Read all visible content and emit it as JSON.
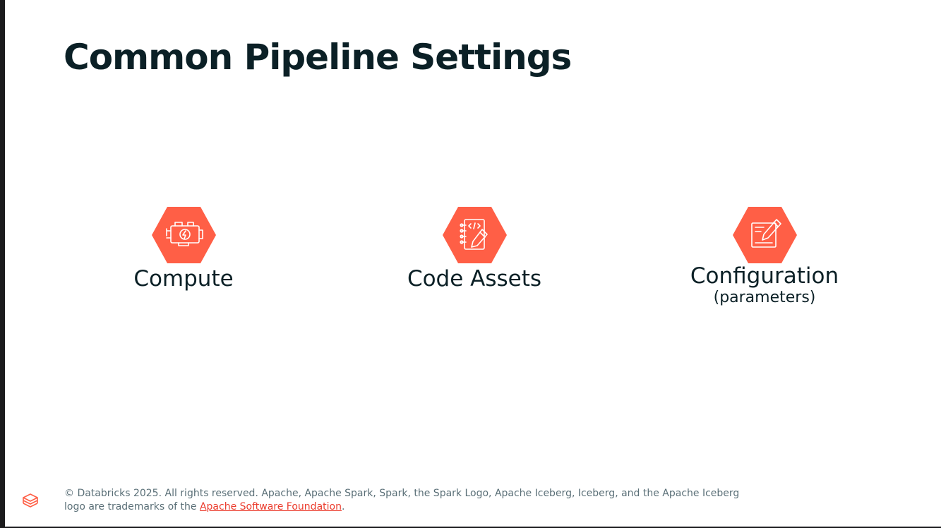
{
  "slide": {
    "title": "Common Pipeline Settings",
    "items": [
      {
        "icon": "engine-icon",
        "label": "Compute",
        "sublabel": ""
      },
      {
        "icon": "code-notebook-icon",
        "label": "Code Assets",
        "sublabel": ""
      },
      {
        "icon": "edit-form-icon",
        "label": "Configuration",
        "sublabel": "(parameters)"
      }
    ]
  },
  "footer": {
    "logo_icon": "databricks-logo-icon",
    "copyright_text": "© Databricks 2025. All rights reserved. Apache, Apache Spark, Spark, the Spark Logo, Apache Iceberg, Iceberg, and the Apache Iceberg logo are trademarks of the ",
    "link_text": "Apache Software Foundation",
    "trailing_text": "."
  },
  "colors": {
    "accent": "#ff5f46",
    "title_text": "#0b2026",
    "footer_text": "#5a6f77",
    "link": "#eb3b2c",
    "background": "#ffffff"
  }
}
